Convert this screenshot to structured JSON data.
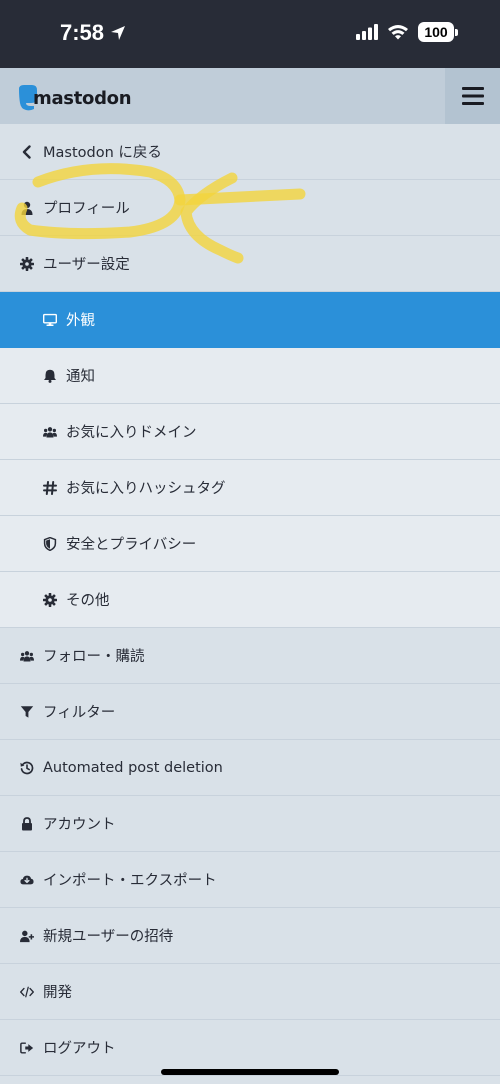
{
  "status_bar": {
    "time": "7:58",
    "battery": "100"
  },
  "header": {
    "logo_text": "mastodon"
  },
  "nav": {
    "back": "Mastodon に戻る",
    "profile": "プロフィール",
    "user_settings": "ユーザー設定",
    "appearance": "外観",
    "notifications": "通知",
    "favorite_domains": "お気に入りドメイン",
    "favorite_hashtags": "お気に入りハッシュタグ",
    "privacy": "安全とプライバシー",
    "other": "その他",
    "follows": "フォロー・購読",
    "filters": "フィルター",
    "auto_delete": "Automated post deletion",
    "account": "アカウント",
    "import_export": "インポート・エクスポート",
    "invites": "新規ユーザーの招待",
    "development": "開発",
    "logout": "ログアウト"
  },
  "colors": {
    "active": "#2b90d9",
    "nav_bg": "#d9e1e8",
    "subnav_bg": "#e6ebf0",
    "header_bg": "#c0cdd9",
    "status_bar_bg": "#282c37",
    "highlight": "#f2d43c"
  }
}
